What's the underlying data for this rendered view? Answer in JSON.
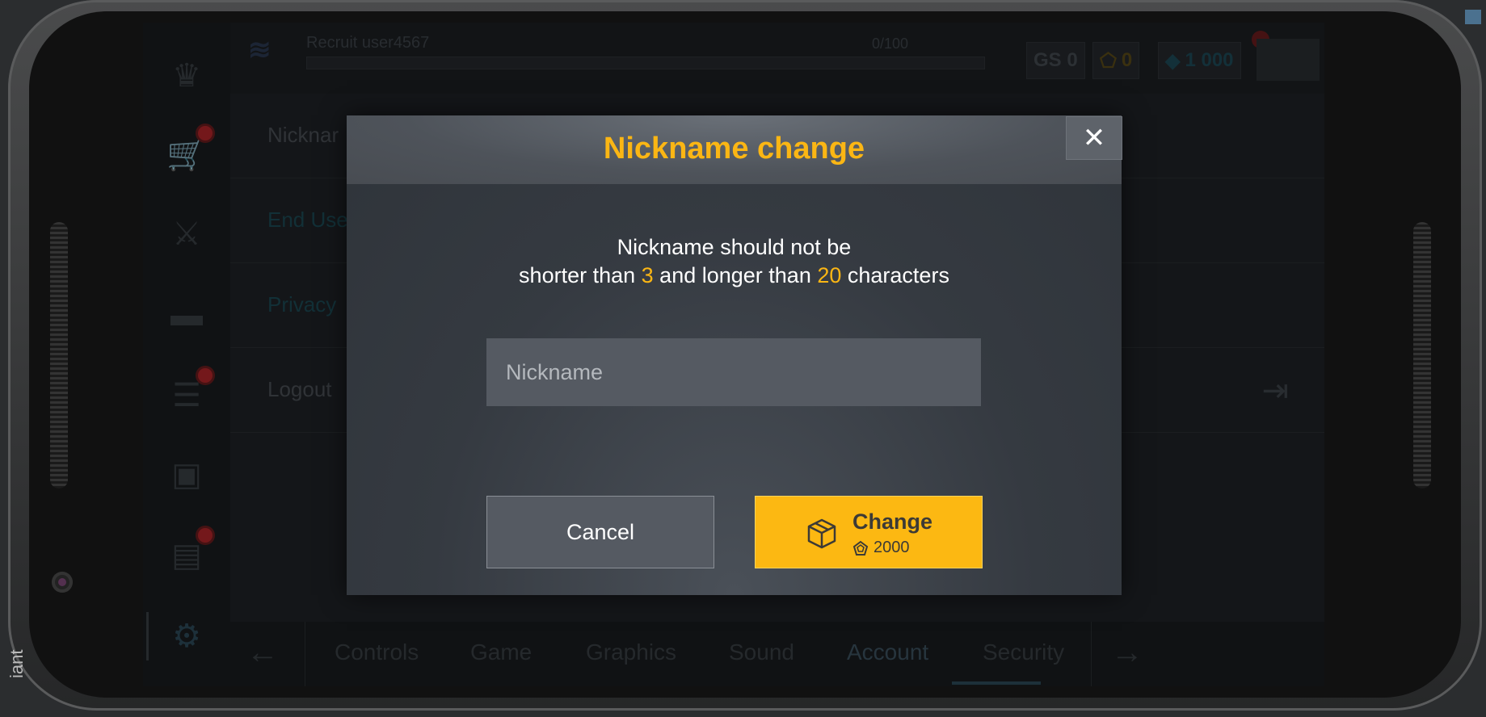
{
  "device": {
    "side_text": "iant"
  },
  "header": {
    "player_name": "Recruit  user4567",
    "xp": "0/100",
    "gs": "GS 0",
    "gold": "0",
    "gems": "1 000"
  },
  "settings_rows": [
    "Nicknar",
    "End Use",
    "Privacy",
    "Logout"
  ],
  "tabs": [
    "Controls",
    "Game",
    "Graphics",
    "Sound",
    "Account",
    "Security"
  ],
  "active_tab": "Account",
  "dialog": {
    "title": "Nickname change",
    "message_line1": "Nickname should not be",
    "msg_shorter": "shorter than ",
    "min_len": "3",
    "msg_and_longer": " and longer than ",
    "max_len": "20",
    "msg_characters": " characters",
    "input_placeholder": "Nickname",
    "input_value": "",
    "close_label": "✕",
    "cancel_label": "Cancel",
    "change_label": "Change",
    "change_price": "2000"
  },
  "colors": {
    "accent": "#fbb614",
    "button_primary": "#fcb812"
  },
  "icons": [
    "rank-icon",
    "crown-icon",
    "cart-icon",
    "sword-icon",
    "tank-icon",
    "tasks-icon",
    "chest-icon",
    "chat-icon",
    "gear-icon",
    "logout-icon",
    "close-icon",
    "box-icon",
    "gold-coin-icon",
    "gem-icon"
  ]
}
